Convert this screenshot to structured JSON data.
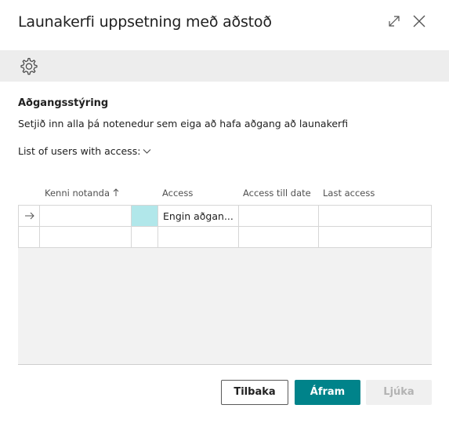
{
  "dialog": {
    "title": "Launakerfi uppsetning með aðstoð"
  },
  "section": {
    "title": "Aðgangsstýring",
    "description": "Setjið inn alla þá notenedur sem eiga að hafa aðgang að launakerfi",
    "list_label": "List of users with access:"
  },
  "table": {
    "columns": {
      "user_id": "Kenni notanda",
      "access": "Access",
      "access_till": "Access till date",
      "last_access": "Last access"
    },
    "rows": [
      {
        "user_id": "",
        "access": "Engin aðgan...",
        "access_till": "",
        "last_access": ""
      },
      {
        "user_id": "",
        "access": "",
        "access_till": "",
        "last_access": ""
      }
    ],
    "active_cell_color": "#b1e7ea"
  },
  "buttons": {
    "back": "Tilbaka",
    "next": "Áfram",
    "finish": "Ljúka"
  },
  "colors": {
    "accent": "#00838a"
  }
}
